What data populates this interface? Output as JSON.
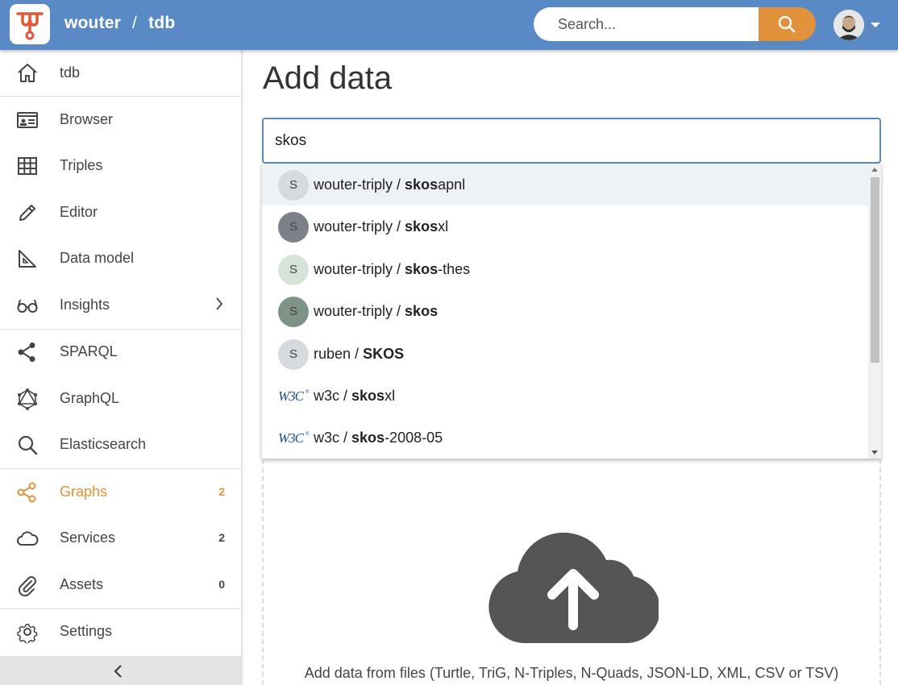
{
  "header": {
    "owner": "wouter",
    "separator": "/",
    "dataset": "tdb",
    "search_placeholder": "Search...",
    "brand_color": "#5a8ac6",
    "accent_color": "#e0913a"
  },
  "sidebar": {
    "items": [
      {
        "label": "tdb",
        "icon": "home-icon"
      },
      {
        "label": "Browser",
        "icon": "browser-card-icon"
      },
      {
        "label": "Triples",
        "icon": "table-grid-icon"
      },
      {
        "label": "Editor",
        "icon": "pencil-icon"
      },
      {
        "label": "Data model",
        "icon": "set-square-icon"
      },
      {
        "label": "Insights",
        "icon": "glasses-icon"
      },
      {
        "label": "SPARQL",
        "icon": "sparql-nodes-icon"
      },
      {
        "label": "GraphQL",
        "icon": "graphql-icon"
      },
      {
        "label": "Elasticsearch",
        "icon": "search-icon"
      },
      {
        "label": "Graphs",
        "icon": "graphs-share-icon",
        "count": "2",
        "active": true
      },
      {
        "label": "Services",
        "icon": "cloud-icon",
        "count": "2"
      },
      {
        "label": "Assets",
        "icon": "paperclip-icon",
        "count": "0"
      },
      {
        "label": "Settings",
        "icon": "gear-icon"
      }
    ]
  },
  "main": {
    "title": "Add data",
    "search_value": "skos",
    "suggestions": [
      {
        "owner": "wouter-triply",
        "sep": " / ",
        "match": "skos",
        "rest": "apnl",
        "avatar": "S",
        "avatar_bg": "#d6d9de"
      },
      {
        "owner": "wouter-triply",
        "sep": " / ",
        "match": "skos",
        "rest": "xl",
        "avatar": "S",
        "avatar_bg": "#7b8089"
      },
      {
        "owner": "wouter-triply",
        "sep": " / ",
        "match": "skos",
        "rest": "-thes",
        "avatar": "S",
        "avatar_bg": "#d5e3d8"
      },
      {
        "owner": "wouter-triply",
        "sep": " / ",
        "match": "skos",
        "rest": "",
        "avatar": "S",
        "avatar_bg": "#7e9287"
      },
      {
        "owner": "ruben",
        "sep": " / ",
        "match": "SKOS",
        "rest": "",
        "avatar": "S",
        "avatar_bg": "#d6d9de"
      },
      {
        "owner": "w3c",
        "sep": " / ",
        "match": "skos",
        "rest": "xl",
        "avatar": "W3C",
        "avatar_bg": ""
      },
      {
        "owner": "w3c",
        "sep": " / ",
        "match": "skos",
        "rest": "-2008-05",
        "avatar": "W3C",
        "avatar_bg": ""
      }
    ],
    "upload_text": "Add data from files (Turtle, TriG, N-Triples, N-Quads, JSON-LD, XML, CSV or TSV)"
  }
}
